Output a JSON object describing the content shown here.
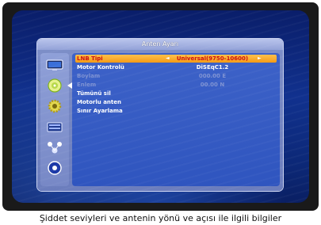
{
  "window": {
    "title": "Anten Ayarı"
  },
  "menu": {
    "rows": [
      {
        "label": "LNB Tipi",
        "value": "Universal(9750-10600)"
      },
      {
        "label": "Motor Kontrolü",
        "value": "DiSEqC1.2"
      },
      {
        "label": "Boylam",
        "value": "000.00 E"
      },
      {
        "label": "Enlem",
        "value": "00.00 N"
      },
      {
        "label": "Tümünü sil",
        "value": ""
      },
      {
        "label": "Motorlu anten",
        "value": ""
      },
      {
        "label": "Sınır Ayarlama",
        "value": ""
      }
    ]
  },
  "sidebar": {
    "icons": [
      "tv-icon",
      "satellite-dish-icon",
      "settings-gear-icon",
      "channel-list-icon",
      "network-icon",
      "info-icon"
    ]
  },
  "caption": "Şiddet seviyleri ve antenin yönü ve açısı ile ilgili bilgiler"
}
